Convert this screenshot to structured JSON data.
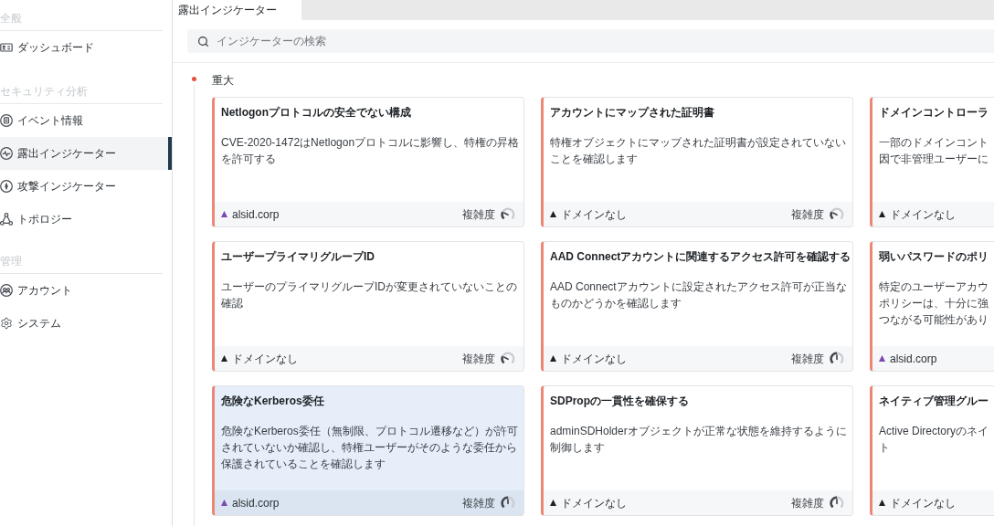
{
  "sidebar": {
    "sections": [
      {
        "title": "全般",
        "items": [
          {
            "label": "ダッシュボード",
            "selected": false
          }
        ]
      },
      {
        "title": "セキュリティ分析",
        "items": [
          {
            "label": "イベント情報",
            "selected": false
          },
          {
            "label": "露出インジケーター",
            "selected": true
          },
          {
            "label": "攻撃インジケーター",
            "selected": false
          },
          {
            "label": "トポロジー",
            "selected": false
          }
        ]
      },
      {
        "title": "管理",
        "items": [
          {
            "label": "アカウント",
            "selected": false
          },
          {
            "label": "システム",
            "selected": false
          }
        ]
      }
    ]
  },
  "tabs": [
    {
      "label": "露出インジケーター",
      "selected": true
    }
  ],
  "search": {
    "placeholder": "インジケーターの検索"
  },
  "groups": [
    {
      "title": "重大",
      "color": "#e4533d",
      "cards": [
        {
          "title": "Netlogonプロトコルの安全でない構成",
          "description": "CVE-2020-1472はNetlogonプロトコルに影響し、特権の昇格を許可する",
          "domain": {
            "label": "alsid.corp",
            "color": "#7b47b3"
          },
          "complexity": {
            "label": "複雑度",
            "kind": "low"
          },
          "selected": false
        },
        {
          "title": "アカウントにマップされた証明書",
          "description": "特権オブジェクトにマップされた証明書が設定されていないことを確認します",
          "domain": {
            "label": "ドメインなし",
            "color": "#1e2124"
          },
          "complexity": {
            "label": "複雑度",
            "kind": "low"
          },
          "selected": false
        },
        {
          "title": "ドメインコントローラ",
          "description_lines": [
            "一部のドメインコント",
            "因で非管理ユーザーに"
          ],
          "domain": {
            "label": "ドメインなし",
            "color": "#1e2124"
          },
          "selected": false
        },
        {
          "title": "ユーザープライマリグループID",
          "description": "ユーザーのプライマリグループIDが変更されていないことの確認",
          "domain": {
            "label": "ドメインなし",
            "color": "#1e2124"
          },
          "complexity": {
            "label": "複雑度",
            "kind": "low"
          },
          "selected": false
        },
        {
          "title": "AAD Connectアカウントに関連するアクセス許可を確認する",
          "description": "AAD Connectアカウントに設定されたアクセス許可が正当なものかどうかを確認します",
          "domain": {
            "label": "ドメインなし",
            "color": "#1e2124"
          },
          "complexity": {
            "label": "複雑度",
            "kind": "medium"
          },
          "selected": false
        },
        {
          "title": "弱いパスワードのポリ",
          "description_lines": [
            "特定のユーザーアカウ",
            "ポリシーは、十分に強",
            "つながる可能性があり"
          ],
          "domain": {
            "label": "alsid.corp",
            "color": "#7b47b3"
          },
          "selected": false
        },
        {
          "title": "危険なKerberos委任",
          "description": "危険なKerberos委任（無制限、プロトコル遷移など）が許可されていないか確認し、特権ユーザーがそのような委任から保護されていることを確認します",
          "domain": {
            "label": "alsid.corp",
            "color": "#7b47b3"
          },
          "complexity": {
            "label": "複雑度",
            "kind": "medium"
          },
          "selected": true
        },
        {
          "title": "SDPropの一貫性を確保する",
          "description": "adminSDHolderオブジェクトが正常な状態を維持するように制御します",
          "domain": {
            "label": "ドメインなし",
            "color": "#1e2124"
          },
          "complexity": {
            "label": "複雑度",
            "kind": "medium"
          },
          "selected": false
        },
        {
          "title": "ネイティブ管理グルー",
          "description_lines": [
            "Active Directoryのネイ",
            "ト"
          ],
          "domain": {
            "label": "ドメインなし",
            "color": "#1e2124"
          },
          "selected": false
        }
      ]
    }
  ]
}
